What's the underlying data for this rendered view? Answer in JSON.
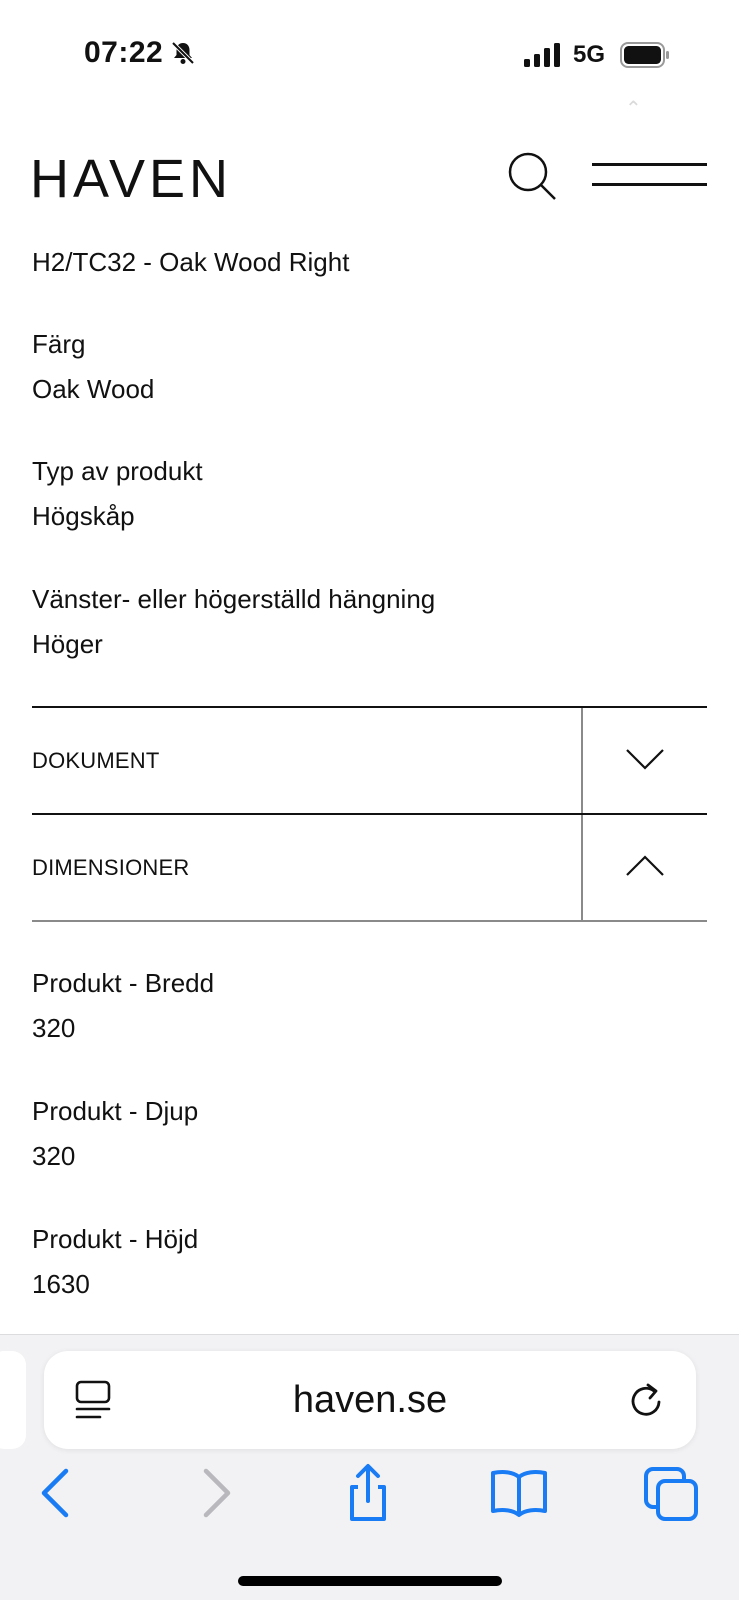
{
  "status_bar": {
    "time": "07:22",
    "network": "5G"
  },
  "header": {
    "logo": "HAVEN"
  },
  "product": {
    "name_value": "H2/TC32 - Oak Wood Right",
    "fields": [
      {
        "label": "Färg",
        "value": "Oak Wood"
      },
      {
        "label": "Typ av produkt",
        "value": "Högskåp"
      },
      {
        "label": "Vänster- eller högerställd hängning",
        "value": "Höger"
      }
    ]
  },
  "accordion": {
    "documents_label": "DOKUMENT",
    "dimensions_label": "DIMENSIONER"
  },
  "dimensions": [
    {
      "label": "Produkt - Bredd",
      "value": "320"
    },
    {
      "label": "Produkt - Djup",
      "value": "320"
    },
    {
      "label": "Produkt - Höjd",
      "value": "1630"
    }
  ],
  "browser": {
    "url": "haven.se"
  },
  "colors": {
    "accent": "#1a7cf5",
    "text": "#111111",
    "disabled": "#b9b9bd"
  }
}
